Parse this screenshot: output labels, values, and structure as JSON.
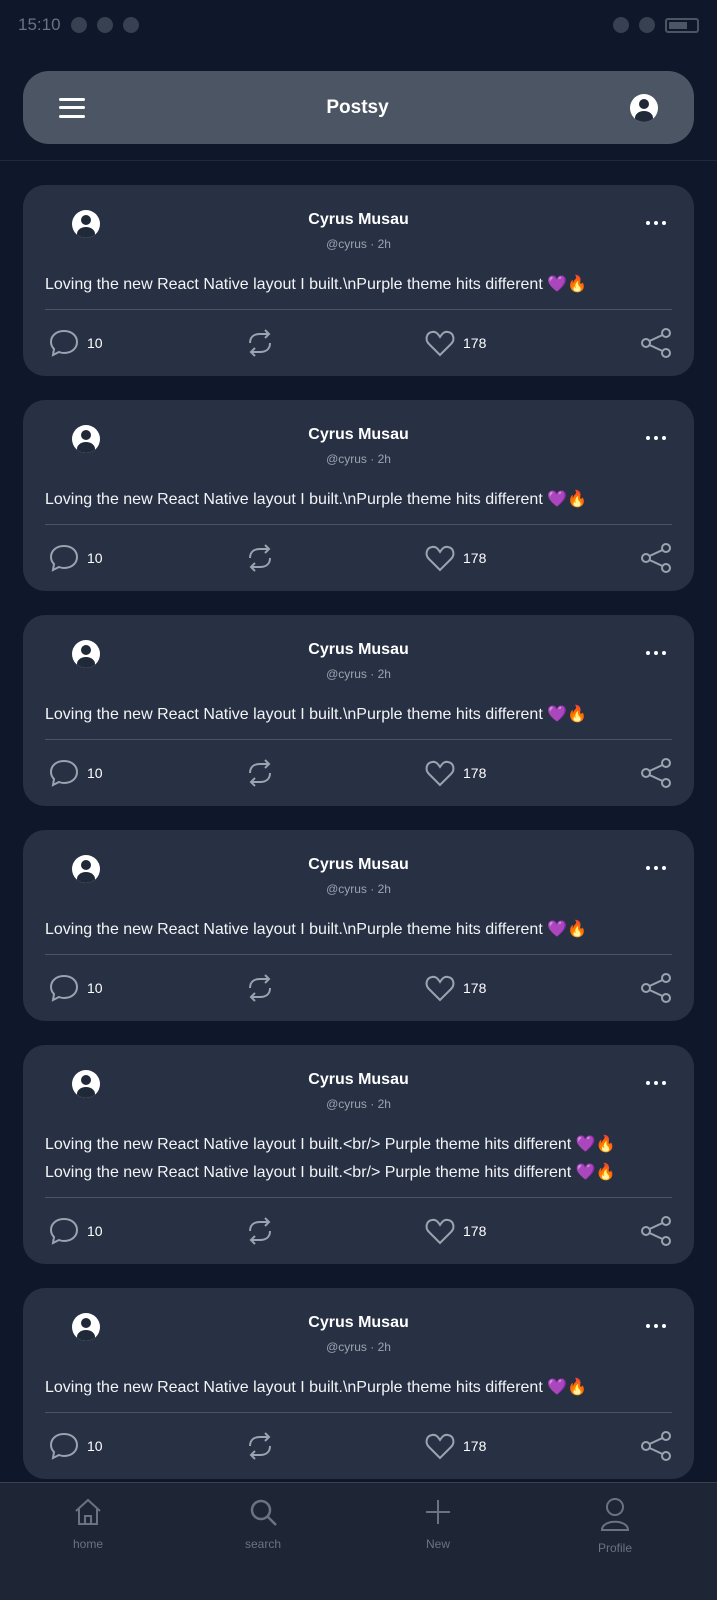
{
  "status_bar": {
    "time": "15:10"
  },
  "header": {
    "title": "Postsy"
  },
  "posts": [
    {
      "name": "Cyrus Musau",
      "meta": "@cyrus · 2h",
      "lines": [
        "Loving the new React Native layout I built.\\nPurple theme hits different 💜🔥"
      ],
      "comments": "10",
      "likes": "178"
    },
    {
      "name": "Cyrus Musau",
      "meta": "@cyrus · 2h",
      "lines": [
        "Loving the new React Native layout I built.\\nPurple theme hits different 💜🔥"
      ],
      "comments": "10",
      "likes": "178"
    },
    {
      "name": "Cyrus Musau",
      "meta": "@cyrus · 2h",
      "lines": [
        "Loving the new React Native layout I built.\\nPurple theme hits different 💜🔥"
      ],
      "comments": "10",
      "likes": "178"
    },
    {
      "name": "Cyrus Musau",
      "meta": "@cyrus · 2h",
      "lines": [
        "Loving the new React Native layout I built.\\nPurple theme hits different 💜🔥"
      ],
      "comments": "10",
      "likes": "178"
    },
    {
      "name": "Cyrus Musau",
      "meta": "@cyrus · 2h",
      "lines": [
        "Loving the new React Native layout I built.<br/> Purple theme hits different 💜🔥",
        "Loving the new React Native layout I built.<br/> Purple theme hits different 💜🔥"
      ],
      "comments": "10",
      "likes": "178"
    },
    {
      "name": "Cyrus Musau",
      "meta": "@cyrus · 2h",
      "lines": [
        "Loving the new React Native layout I built.\\nPurple theme hits different 💜🔥"
      ],
      "comments": "10",
      "likes": "178"
    }
  ],
  "nav": [
    {
      "label": "home",
      "icon": "home-icon"
    },
    {
      "label": "search",
      "icon": "search-icon"
    },
    {
      "label": "New",
      "icon": "plus-icon"
    },
    {
      "label": "Profile",
      "icon": "user-icon"
    }
  ],
  "colors": {
    "background": "#0f172a",
    "card": "#283044",
    "header": "#4b5563",
    "nav": "#1e2535"
  }
}
